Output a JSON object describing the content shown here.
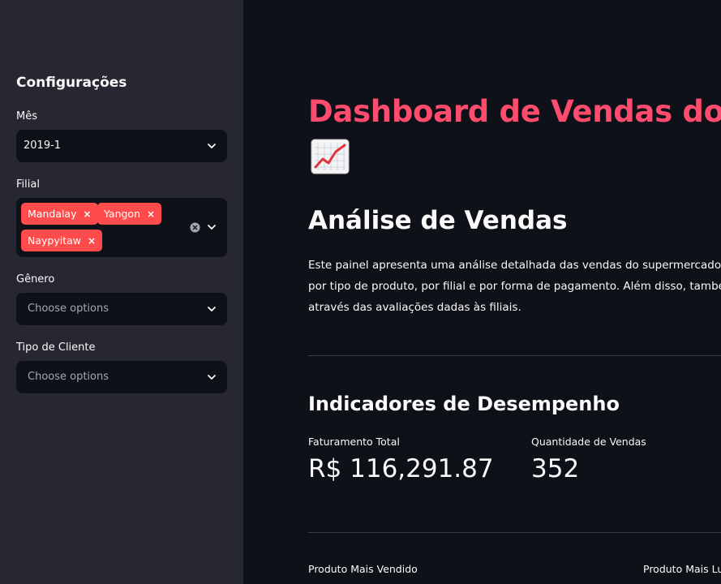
{
  "sidebar": {
    "title": "Configurações",
    "month": {
      "label": "Mês",
      "value": "2019-1"
    },
    "branch": {
      "label": "Filial",
      "tags": [
        "Mandalay",
        "Yangon",
        "Naypyitaw"
      ]
    },
    "gender": {
      "label": "Gênero",
      "placeholder": "Choose options"
    },
    "customer_type": {
      "label": "Tipo de Cliente",
      "placeholder": "Choose options"
    }
  },
  "main": {
    "title": "Dashboard de Vendas do Supermercado",
    "title_emoji": "chart-increasing-icon",
    "section_heading": "Análise de Vendas",
    "description_lines": [
      "Este painel apresenta uma análise detalhada das vendas do supermercado, p",
      "por tipo de produto, por filial e por forma de pagamento. Além disso, també",
      "através das avaliações dadas às filiais."
    ],
    "kpi_heading": "Indicadores de Desempenho",
    "metrics": [
      {
        "label": "Faturamento Total",
        "value": "R$ 116,291.87"
      },
      {
        "label": "Quantidade de Vendas",
        "value": "352"
      }
    ],
    "bottom_labels": [
      "Produto Mais Vendido",
      "Produto Mais Lu"
    ]
  },
  "colors": {
    "accent": "#ff4b4b",
    "title": "#ff4b6e",
    "sidebar_bg": "#262730",
    "main_bg": "#0e1117"
  }
}
